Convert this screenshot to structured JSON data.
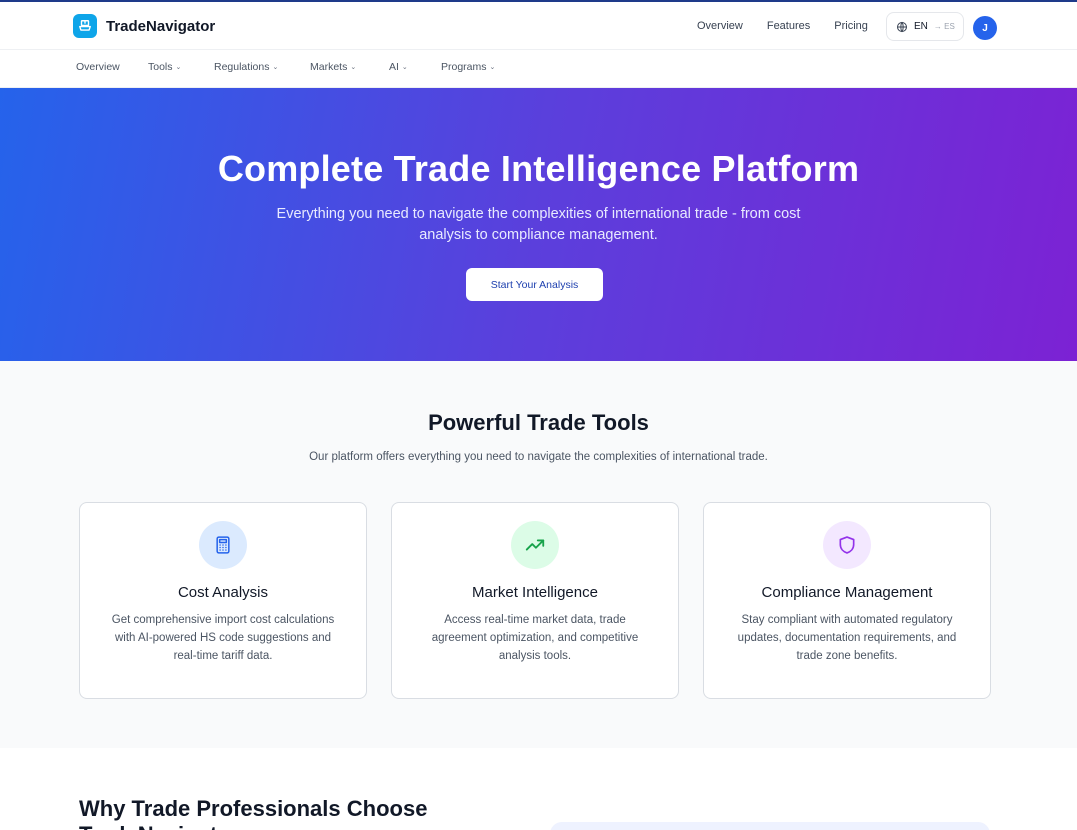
{
  "app": {
    "name": "TradeNavigator"
  },
  "header": {
    "nav": [
      "Overview",
      "Features",
      "Pricing"
    ],
    "lang_current": "EN",
    "lang_alt": "→ ES",
    "avatar_initial": "J"
  },
  "subnav": [
    {
      "label": "Overview",
      "dropdown": false
    },
    {
      "label": "Tools",
      "dropdown": true
    },
    {
      "label": "Regulations",
      "dropdown": true
    },
    {
      "label": "Markets",
      "dropdown": true
    },
    {
      "label": "AI",
      "dropdown": true
    },
    {
      "label": "Programs",
      "dropdown": true
    }
  ],
  "hero": {
    "title": "Complete Trade Intelligence Platform",
    "subtitle": "Everything you need to navigate the complexities of international trade - from cost analysis to compliance management.",
    "cta": "Start Your Analysis"
  },
  "tools": {
    "title": "Powerful Trade Tools",
    "subtitle": "Our platform offers everything you need to navigate the complexities of international trade.",
    "cards": [
      {
        "title": "Cost Analysis",
        "desc": "Get comprehensive import cost calculations with AI-powered HS code suggestions and real-time tariff data.",
        "icon": "calculator-icon",
        "color": "#2563eb",
        "bg": "#dbeafe"
      },
      {
        "title": "Market Intelligence",
        "desc": "Access real-time market data, trade agreement optimization, and competitive analysis tools.",
        "icon": "trending-up-icon",
        "color": "#16a34a",
        "bg": "#dcfce7"
      },
      {
        "title": "Compliance Management",
        "desc": "Stay compliant with automated regulatory updates, documentation requirements, and trade zone benefits.",
        "icon": "shield-icon",
        "color": "#9333ea",
        "bg": "#f3e8ff"
      }
    ]
  },
  "why": {
    "title": "Why Trade Professionals Choose TradeNavigator"
  },
  "colors": {
    "accent": "#2563eb",
    "hero_start": "#2563eb",
    "hero_end": "#7c22d4"
  }
}
